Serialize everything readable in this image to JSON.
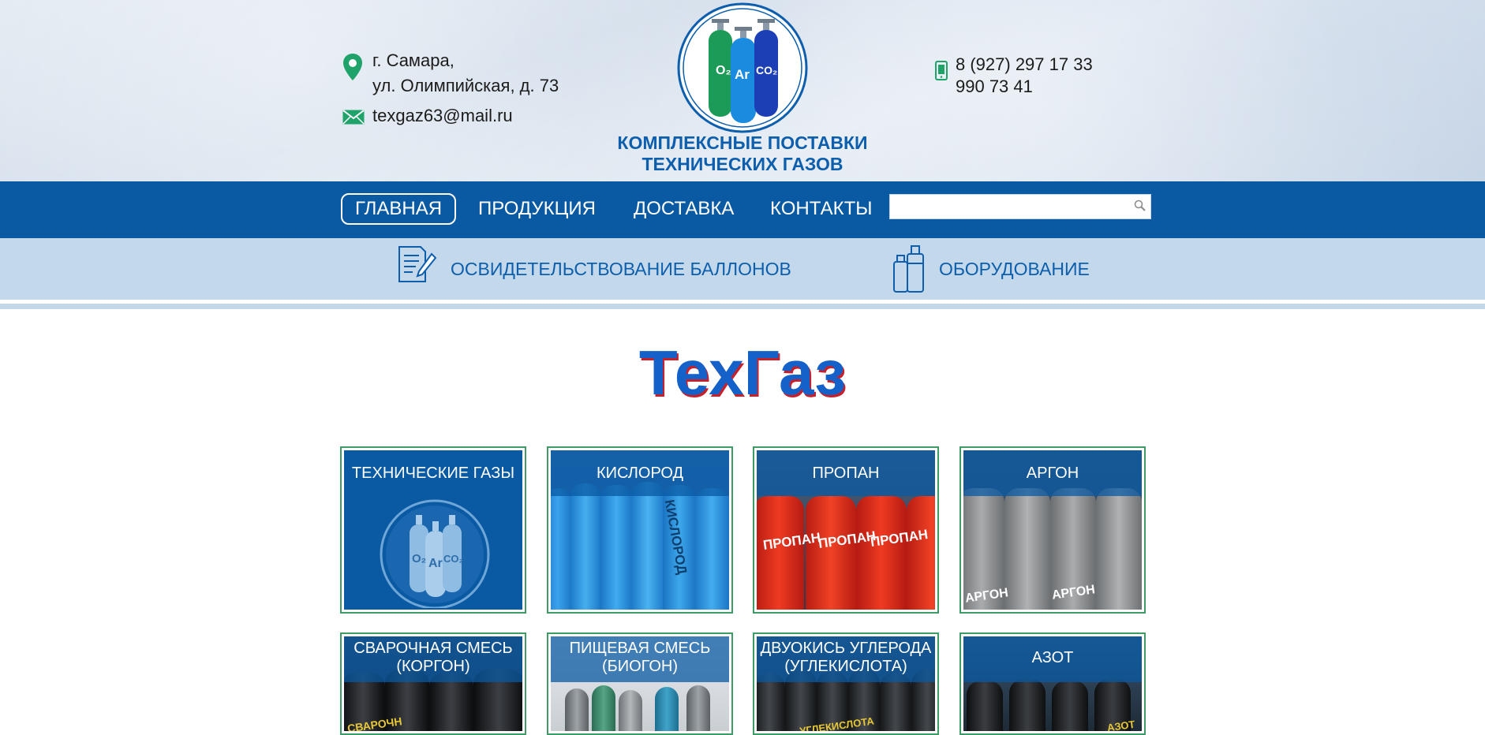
{
  "header": {
    "address_line1": "г. Самара,",
    "address_line2": "ул. Олимпийская, д. 73",
    "email": "texgaz63@mail.ru",
    "phone_line1": "8 (927) 297 17 33",
    "phone_line2": "990 73 41",
    "logo_line1": "КОМПЛЕКСНЫЕ ПОСТАВКИ",
    "logo_line2": "ТЕХНИЧЕСКИХ ГАЗОВ",
    "logo_badge": "O₂ Ar CO₂"
  },
  "nav": {
    "items": [
      {
        "label": "ГЛАВНАЯ",
        "active": true
      },
      {
        "label": "ПРОДУКЦИЯ"
      },
      {
        "label": "ДОСТАВКА"
      },
      {
        "label": "КОНТАКТЫ"
      }
    ],
    "search_placeholder": ""
  },
  "subnav": {
    "items": [
      {
        "label": "ОСВИДЕТЕЛЬСТВОВАНИЕ БАЛЛОНОВ",
        "icon": "document-pen-icon"
      },
      {
        "label": "ОБОРУДОВАНИЕ",
        "icon": "gas-canisters-icon"
      }
    ]
  },
  "main": {
    "title": "ТехГаз",
    "tiles": [
      {
        "label_line1": "ТЕХНИЧЕСКИЕ ГАЗЫ",
        "label_line2": "",
        "badge": "O₂ Ar CO₂"
      },
      {
        "label_line1": "КИСЛОРОД",
        "label_line2": "",
        "stencil": "КИСЛОРОД"
      },
      {
        "label_line1": "ПРОПАН",
        "label_line2": "",
        "stencil": "ПРОПАН"
      },
      {
        "label_line1": "АРГОН",
        "label_line2": "",
        "stencil": "АРГОН"
      },
      {
        "label_line1": "СВАРОЧНАЯ СМЕСЬ",
        "label_line2": "(КОРГОН)",
        "stencil": "СВАРОЧН"
      },
      {
        "label_line1": "ПИЩЕВАЯ СМЕСЬ",
        "label_line2": "(БИОГОН)"
      },
      {
        "label_line1": "ДВУОКИСЬ УГЛЕРОДА",
        "label_line2": "(УГЛЕКИСЛОТА)",
        "stencil": "УГЛЕКИСЛОТА"
      },
      {
        "label_line1": "АЗОТ",
        "label_line2": "",
        "stencil": "АЗОТ"
      }
    ]
  },
  "colors": {
    "brand_blue": "#0a5aa3",
    "light_blue": "#c3d8ea",
    "tile_border": "#3e9a66",
    "title_shadow": "#c8202a"
  }
}
